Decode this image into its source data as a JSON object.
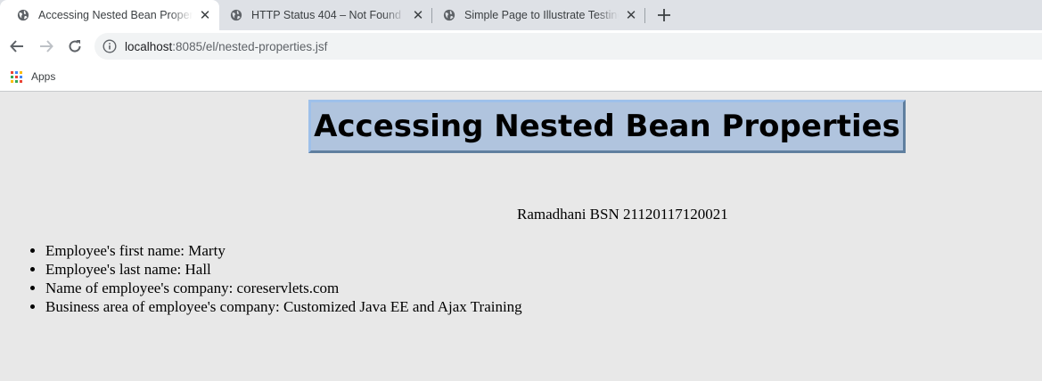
{
  "browser": {
    "tabs": [
      {
        "title": "Accessing Nested Bean Properties",
        "active": true
      },
      {
        "title": "HTTP Status 404 – Not Found",
        "active": false
      },
      {
        "title": "Simple Page to Illustrate Testing",
        "active": false
      }
    ],
    "new_tab_icon": "plus-icon",
    "address": {
      "host": "localhost",
      "path": ":8085/el/nested-properties.jsf"
    },
    "bookmarks": {
      "apps_label": "Apps"
    }
  },
  "page": {
    "heading": "Accessing Nested Bean Properties",
    "credit": "Ramadhani BSN 21120117120021",
    "employee_items": [
      "Employee's first name: Marty",
      "Employee's last name: Hall",
      "Name of employee's company: coreservlets.com",
      "Business area of employee's company: Customized Java EE and Ajax Training"
    ]
  },
  "colors": {
    "heading_bg": "#b0c4de",
    "page_bg": "#e8e8e8",
    "tabstrip_bg": "#dee1e6"
  }
}
